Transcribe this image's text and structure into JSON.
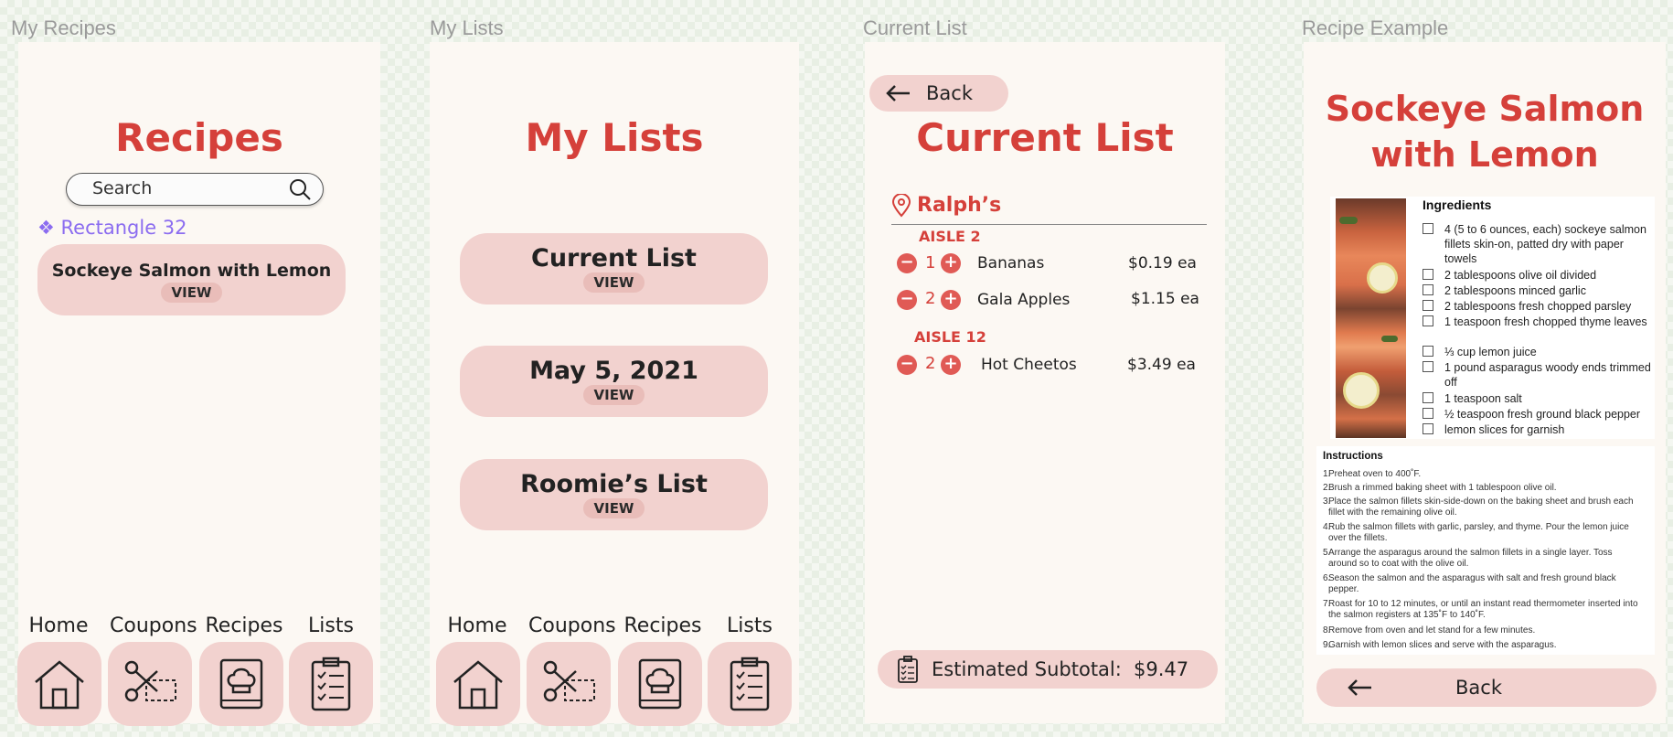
{
  "frames": {
    "my_recipes": {
      "label": "My Recipes",
      "title": "Recipes",
      "search_placeholder": "Search",
      "component_tag": "Rectangle 32",
      "recipe_card": {
        "title": "Sockeye Salmon with Lemon",
        "view": "VIEW"
      }
    },
    "my_lists": {
      "label": "My Lists",
      "title": "My Lists",
      "cards": [
        {
          "title": "Current List",
          "view": "VIEW"
        },
        {
          "title": "May 5, 2021",
          "view": "VIEW"
        },
        {
          "title": "Roomie’s List",
          "view": "VIEW"
        }
      ]
    },
    "current_list": {
      "label": "Current List",
      "back": "Back",
      "title": "Current List",
      "store": "Ralph’s",
      "aisles": [
        {
          "name": "AISLE 2",
          "items": [
            {
              "qty": "1",
              "name": "Bananas",
              "price": "$0.19 ea"
            },
            {
              "qty": "2",
              "name": "Gala Apples",
              "price": "$1.15 ea"
            }
          ]
        },
        {
          "name": "AISLE 12",
          "items": [
            {
              "qty": "2",
              "name": "Hot Cheetos",
              "price": "$3.49 ea"
            }
          ]
        }
      ],
      "subtotal_label": "Estimated Subtotal:",
      "subtotal_value": "$9.47"
    },
    "recipe_example": {
      "label": "Recipe Example",
      "title_line1": "Sockeye Salmon",
      "title_line2": "with Lemon",
      "ingredients_heading": "Ingredients",
      "ingredients": [
        "4 (5 to 6 ounces, each) sockeye salmon fillets skin-on, patted dry with paper towels",
        "2 tablespoons olive oil divided",
        "2 tablespoons minced garlic",
        "2 tablespoons fresh chopped parsley",
        "1 teaspoon fresh chopped thyme leaves",
        "⅓ cup lemon juice",
        "1 pound asparagus woody ends trimmed off",
        "1 teaspoon salt",
        "½ teaspoon fresh ground black pepper",
        "lemon slices for garnish"
      ],
      "instructions_heading": "Instructions",
      "instructions": [
        "Preheat oven to 400˚F.",
        "Brush a rimmed baking sheet with 1 tablespoon olive oil.",
        "Place the salmon fillets skin-side-down on the baking sheet and brush each fillet with the remaining olive oil.",
        "Rub the salmon fillets with garlic, parsley, and thyme. Pour the lemon juice over the fillets.",
        "Arrange the asparagus around the salmon fillets in a single layer. Toss around so to coat with the olive oil.",
        "Season the salmon and the asparagus with salt and fresh ground black pepper.",
        "Roast for 10 to 12 minutes, or until an instant read thermometer inserted into the salmon registers at 135˚F to 140˚F.",
        "Remove from oven and let stand for a few minutes.",
        "Garnish with lemon slices and serve with the asparagus."
      ],
      "back": "Back"
    }
  },
  "nav": {
    "home": "Home",
    "coupons": "Coupons",
    "recipes": "Recipes",
    "lists": "Lists"
  },
  "colors": {
    "accent": "#d5403a",
    "card": "#f2d2cf",
    "frame_bg": "#fcf8f3",
    "component_tag": "#8b6cf0"
  },
  "icons": {
    "search": "search-icon",
    "home": "house-icon",
    "coupons": "scissors-coupon-icon",
    "recipes": "chef-hat-book-icon",
    "lists": "clipboard-checklist-icon",
    "back": "arrow-left-icon",
    "location": "map-pin-icon"
  }
}
